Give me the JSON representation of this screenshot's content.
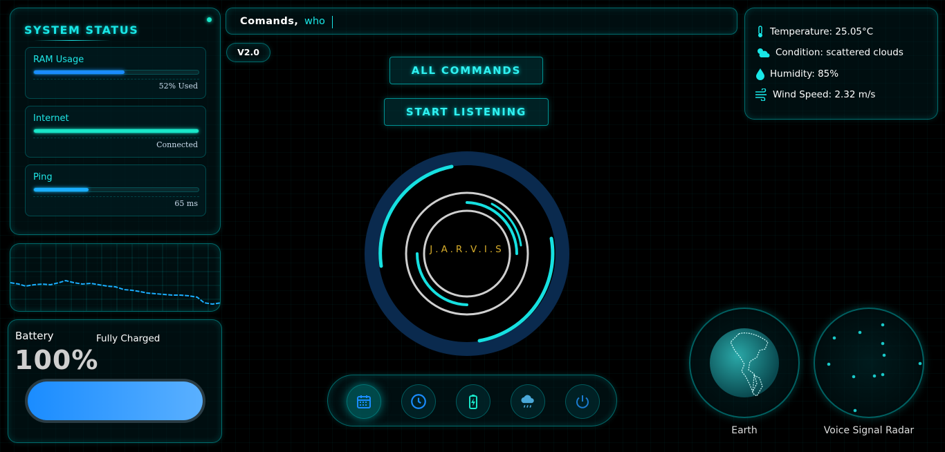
{
  "system_status": {
    "title": "SYSTEM STATUS",
    "stats": [
      {
        "label": "RAM Usage",
        "value": "52% Used",
        "fill": 0.55,
        "color": "#1a8cff"
      },
      {
        "label": "Internet",
        "value": "Connected",
        "fill": 1.0,
        "color": "#19e6c8"
      },
      {
        "label": "Ping",
        "value": "65 ms",
        "fill": 0.33,
        "color": "#1aaeff"
      }
    ]
  },
  "battery": {
    "label": "Battery",
    "status": "Fully Charged",
    "percent_text": "100%",
    "level": 1.0
  },
  "command_bar": {
    "prefix": "Comands,",
    "text": "who"
  },
  "version": "V2.0",
  "buttons": {
    "all_commands": "ALL COMMANDS",
    "start_listening": "START LISTENING"
  },
  "core": {
    "label": "J.A.R.V.I.S"
  },
  "dock": [
    {
      "icon": "calendar-icon"
    },
    {
      "icon": "clock-icon"
    },
    {
      "icon": "battery-charging-icon"
    },
    {
      "icon": "weather-icon"
    },
    {
      "icon": "power-icon"
    }
  ],
  "weather": {
    "temperature": "Temperature: 25.05°C",
    "condition": "Condition: scattered clouds",
    "humidity": "Humidity: 85%",
    "wind": "Wind Speed: 2.32 m/s"
  },
  "widgets": {
    "earth_label": "Earth",
    "radar_label": "Voice Signal Radar"
  },
  "colors": {
    "accent": "#19e6e6",
    "core_text": "#d7ad2b",
    "battery": "#1a8cff"
  }
}
